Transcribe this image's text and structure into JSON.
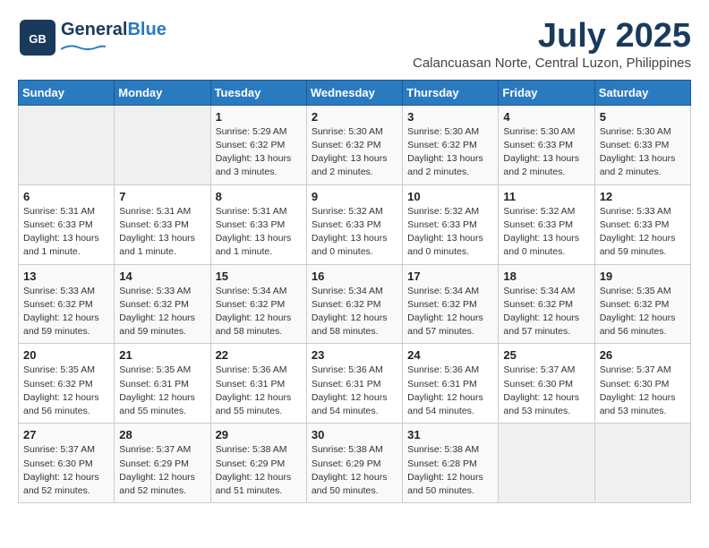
{
  "logo": {
    "part1": "General",
    "part2": "Blue"
  },
  "header": {
    "month": "July 2025",
    "location": "Calancuasan Norte, Central Luzon, Philippines"
  },
  "weekdays": [
    "Sunday",
    "Monday",
    "Tuesday",
    "Wednesday",
    "Thursday",
    "Friday",
    "Saturday"
  ],
  "weeks": [
    [
      {
        "day": "",
        "info": ""
      },
      {
        "day": "",
        "info": ""
      },
      {
        "day": "1",
        "info": "Sunrise: 5:29 AM\nSunset: 6:32 PM\nDaylight: 13 hours and 3 minutes."
      },
      {
        "day": "2",
        "info": "Sunrise: 5:30 AM\nSunset: 6:32 PM\nDaylight: 13 hours and 2 minutes."
      },
      {
        "day": "3",
        "info": "Sunrise: 5:30 AM\nSunset: 6:32 PM\nDaylight: 13 hours and 2 minutes."
      },
      {
        "day": "4",
        "info": "Sunrise: 5:30 AM\nSunset: 6:33 PM\nDaylight: 13 hours and 2 minutes."
      },
      {
        "day": "5",
        "info": "Sunrise: 5:30 AM\nSunset: 6:33 PM\nDaylight: 13 hours and 2 minutes."
      }
    ],
    [
      {
        "day": "6",
        "info": "Sunrise: 5:31 AM\nSunset: 6:33 PM\nDaylight: 13 hours and 1 minute."
      },
      {
        "day": "7",
        "info": "Sunrise: 5:31 AM\nSunset: 6:33 PM\nDaylight: 13 hours and 1 minute."
      },
      {
        "day": "8",
        "info": "Sunrise: 5:31 AM\nSunset: 6:33 PM\nDaylight: 13 hours and 1 minute."
      },
      {
        "day": "9",
        "info": "Sunrise: 5:32 AM\nSunset: 6:33 PM\nDaylight: 13 hours and 0 minutes."
      },
      {
        "day": "10",
        "info": "Sunrise: 5:32 AM\nSunset: 6:33 PM\nDaylight: 13 hours and 0 minutes."
      },
      {
        "day": "11",
        "info": "Sunrise: 5:32 AM\nSunset: 6:33 PM\nDaylight: 13 hours and 0 minutes."
      },
      {
        "day": "12",
        "info": "Sunrise: 5:33 AM\nSunset: 6:33 PM\nDaylight: 12 hours and 59 minutes."
      }
    ],
    [
      {
        "day": "13",
        "info": "Sunrise: 5:33 AM\nSunset: 6:32 PM\nDaylight: 12 hours and 59 minutes."
      },
      {
        "day": "14",
        "info": "Sunrise: 5:33 AM\nSunset: 6:32 PM\nDaylight: 12 hours and 59 minutes."
      },
      {
        "day": "15",
        "info": "Sunrise: 5:34 AM\nSunset: 6:32 PM\nDaylight: 12 hours and 58 minutes."
      },
      {
        "day": "16",
        "info": "Sunrise: 5:34 AM\nSunset: 6:32 PM\nDaylight: 12 hours and 58 minutes."
      },
      {
        "day": "17",
        "info": "Sunrise: 5:34 AM\nSunset: 6:32 PM\nDaylight: 12 hours and 57 minutes."
      },
      {
        "day": "18",
        "info": "Sunrise: 5:34 AM\nSunset: 6:32 PM\nDaylight: 12 hours and 57 minutes."
      },
      {
        "day": "19",
        "info": "Sunrise: 5:35 AM\nSunset: 6:32 PM\nDaylight: 12 hours and 56 minutes."
      }
    ],
    [
      {
        "day": "20",
        "info": "Sunrise: 5:35 AM\nSunset: 6:32 PM\nDaylight: 12 hours and 56 minutes."
      },
      {
        "day": "21",
        "info": "Sunrise: 5:35 AM\nSunset: 6:31 PM\nDaylight: 12 hours and 55 minutes."
      },
      {
        "day": "22",
        "info": "Sunrise: 5:36 AM\nSunset: 6:31 PM\nDaylight: 12 hours and 55 minutes."
      },
      {
        "day": "23",
        "info": "Sunrise: 5:36 AM\nSunset: 6:31 PM\nDaylight: 12 hours and 54 minutes."
      },
      {
        "day": "24",
        "info": "Sunrise: 5:36 AM\nSunset: 6:31 PM\nDaylight: 12 hours and 54 minutes."
      },
      {
        "day": "25",
        "info": "Sunrise: 5:37 AM\nSunset: 6:30 PM\nDaylight: 12 hours and 53 minutes."
      },
      {
        "day": "26",
        "info": "Sunrise: 5:37 AM\nSunset: 6:30 PM\nDaylight: 12 hours and 53 minutes."
      }
    ],
    [
      {
        "day": "27",
        "info": "Sunrise: 5:37 AM\nSunset: 6:30 PM\nDaylight: 12 hours and 52 minutes."
      },
      {
        "day": "28",
        "info": "Sunrise: 5:37 AM\nSunset: 6:29 PM\nDaylight: 12 hours and 52 minutes."
      },
      {
        "day": "29",
        "info": "Sunrise: 5:38 AM\nSunset: 6:29 PM\nDaylight: 12 hours and 51 minutes."
      },
      {
        "day": "30",
        "info": "Sunrise: 5:38 AM\nSunset: 6:29 PM\nDaylight: 12 hours and 50 minutes."
      },
      {
        "day": "31",
        "info": "Sunrise: 5:38 AM\nSunset: 6:28 PM\nDaylight: 12 hours and 50 minutes."
      },
      {
        "day": "",
        "info": ""
      },
      {
        "day": "",
        "info": ""
      }
    ]
  ]
}
